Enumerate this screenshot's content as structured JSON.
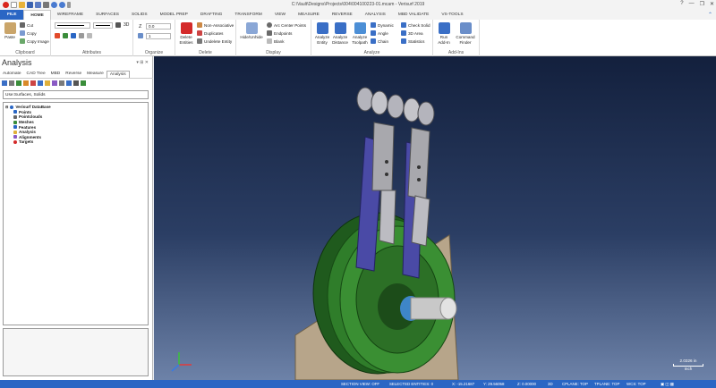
{
  "window": {
    "title": "C:\\Vault\\Designs\\Projects\\004\\004100223-01.mcam - Verisurf 2019",
    "controls": [
      "?",
      "—",
      "❐",
      "✕"
    ]
  },
  "tabs": [
    "FILE",
    "HOME",
    "WIREFRAME",
    "SURFACES",
    "SOLIDS",
    "MODEL PREP",
    "DRAFTING",
    "TRANSFORM",
    "VIEW",
    "MEASURE",
    "REVERSE",
    "ANALYSIS",
    "MBD VALIDATE",
    "VS-TOOLS"
  ],
  "active_tab": "HOME",
  "ribbon": {
    "clipboard": {
      "label": "Clipboard",
      "paste": "Paste",
      "cut": "Cut",
      "copy": "Copy",
      "copy_image": "Copy Image"
    },
    "attributes": {
      "label": "Attributes",
      "view_3d": "3D"
    },
    "organize": {
      "label": "Organize",
      "z_label": "Z",
      "z_value": "0.0",
      "level_value": "1"
    },
    "delete": {
      "label": "Delete",
      "delete_entities": "Delete\nEntities",
      "non_associative": "Non-Associative",
      "duplicates": "Duplicates",
      "undelete": "Undelete Entity"
    },
    "display": {
      "label": "Display",
      "hide_unhide": "Hide/Unhide",
      "arc_center_points": "Arc Center Points",
      "endpoints": "Endpoints",
      "blank": "Blank"
    },
    "analyze": {
      "label": "Analyze",
      "analyze_entity": "Analyze\nEntity",
      "analyze_distance": "Analyze\nDistance",
      "analyze_toolpath": "Analyze\nToolpath",
      "dynamic": "Dynamic",
      "angle": "Angle",
      "chain": "Chain",
      "check_solid": "Check Solid",
      "area_3d": "3D Area",
      "statistics": "Statistics"
    },
    "addins": {
      "label": "Add-Ins",
      "run_addin": "Run\nAdd-In",
      "command_finder": "Command\nFinder"
    }
  },
  "panel": {
    "title": "Analysis",
    "tabs": [
      "Automate",
      "CAD Tree",
      "MBD",
      "Reverse",
      "Measure",
      "Analysis"
    ],
    "active_tab": "Analysis",
    "filter": "Use:Surfaces, Solids",
    "tree": {
      "root": "Verisurf DataBase",
      "children": [
        "Points",
        "Pointclouds",
        "Meshes",
        "Features",
        "Analysis",
        "Alignments",
        "Targets"
      ]
    }
  },
  "viewport": {
    "scale_value": "2.0326 in",
    "scale_unit": "Inch"
  },
  "status": {
    "section_view": "SECTION VIEW: OFF",
    "selected_entities": "SELECTED ENTITIES: 0",
    "x": "X:  -15.21687",
    "y": "Y:  29.56058",
    "z": "Z:  0.00000",
    "mode": "3D",
    "cplane": "CPLANE: TOP",
    "tplane": "TPLANE: TOP",
    "wcs": "WCS: TOP"
  },
  "colors": {
    "accent": "#2a66c4",
    "viewport_top": "#13203d",
    "viewport_bottom": "#6d82a8",
    "part_green": "#2f7d2a",
    "link_purple": "#4a4aa6"
  }
}
